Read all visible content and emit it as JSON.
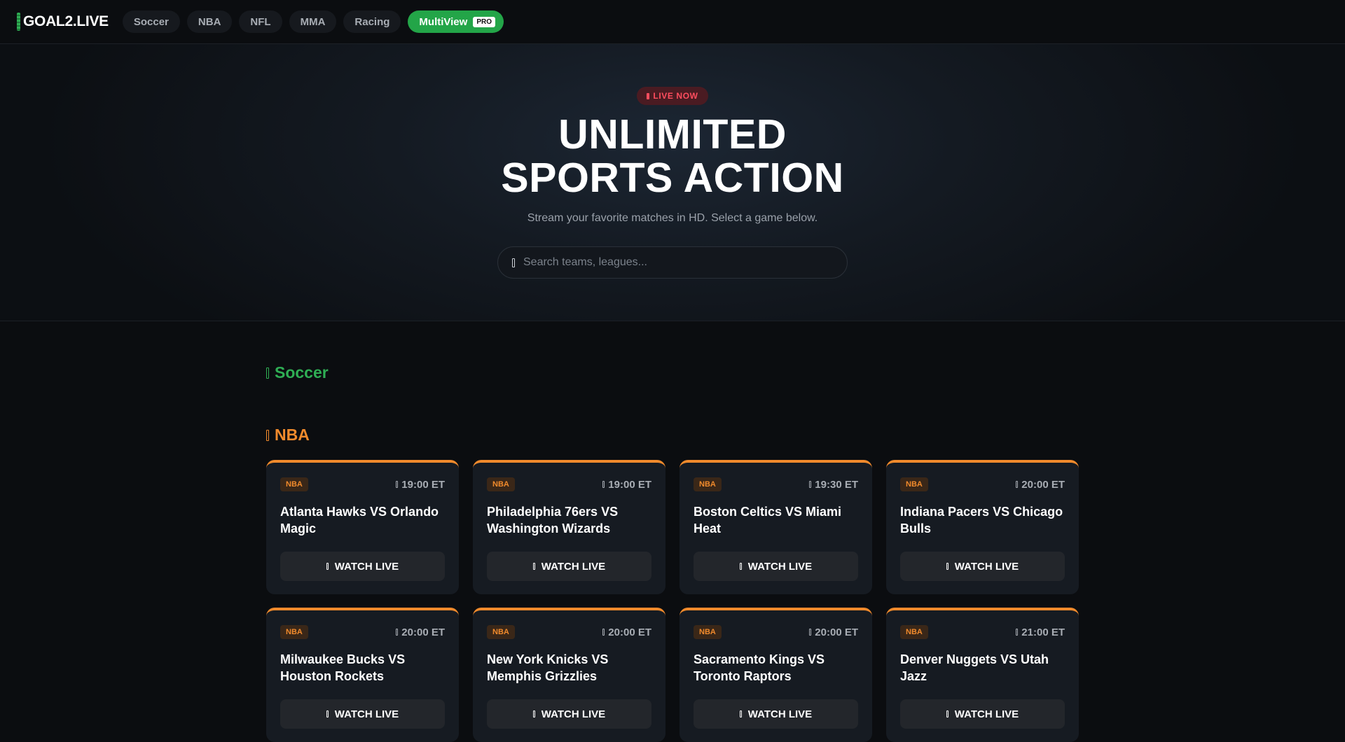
{
  "brand": {
    "name": "GOAL2.LIVE",
    "accent": "#2fae54"
  },
  "nav": {
    "items": [
      {
        "label": "Soccer"
      },
      {
        "label": "NBA"
      },
      {
        "label": "NFL"
      },
      {
        "label": "MMA"
      },
      {
        "label": "Racing"
      }
    ],
    "multiview": {
      "label": "MultiView",
      "badge": "PRO",
      "color": "#23a548"
    }
  },
  "hero": {
    "badge": "LIVE NOW",
    "title_line1": "UNLIMITED",
    "title_line2": "SPORTS ACTION",
    "subtitle": "Stream your favorite matches in HD. Select a game below.",
    "search_placeholder": "Search teams, leagues..."
  },
  "sections": {
    "soccer": {
      "title": "Soccer",
      "color": "#2fae54"
    },
    "nba": {
      "title": "NBA",
      "color": "#f08a2c",
      "games": [
        {
          "league": "NBA",
          "time": "19:00 ET",
          "title": "Atlanta Hawks VS Orlando Magic",
          "cta": "WATCH LIVE"
        },
        {
          "league": "NBA",
          "time": "19:00 ET",
          "title": "Philadelphia 76ers VS Washington Wizards",
          "cta": "WATCH LIVE"
        },
        {
          "league": "NBA",
          "time": "19:30 ET",
          "title": "Boston Celtics VS Miami Heat",
          "cta": "WATCH LIVE"
        },
        {
          "league": "NBA",
          "time": "20:00 ET",
          "title": "Indiana Pacers VS Chicago Bulls",
          "cta": "WATCH LIVE"
        },
        {
          "league": "NBA",
          "time": "20:00 ET",
          "title": "Milwaukee Bucks VS Houston Rockets",
          "cta": "WATCH LIVE"
        },
        {
          "league": "NBA",
          "time": "20:00 ET",
          "title": "New York Knicks VS Memphis Grizzlies",
          "cta": "WATCH LIVE"
        },
        {
          "league": "NBA",
          "time": "20:00 ET",
          "title": "Sacramento Kings VS Toronto Raptors",
          "cta": "WATCH LIVE"
        },
        {
          "league": "NBA",
          "time": "21:00 ET",
          "title": "Denver Nuggets VS Utah Jazz",
          "cta": "WATCH LIVE"
        }
      ]
    }
  }
}
